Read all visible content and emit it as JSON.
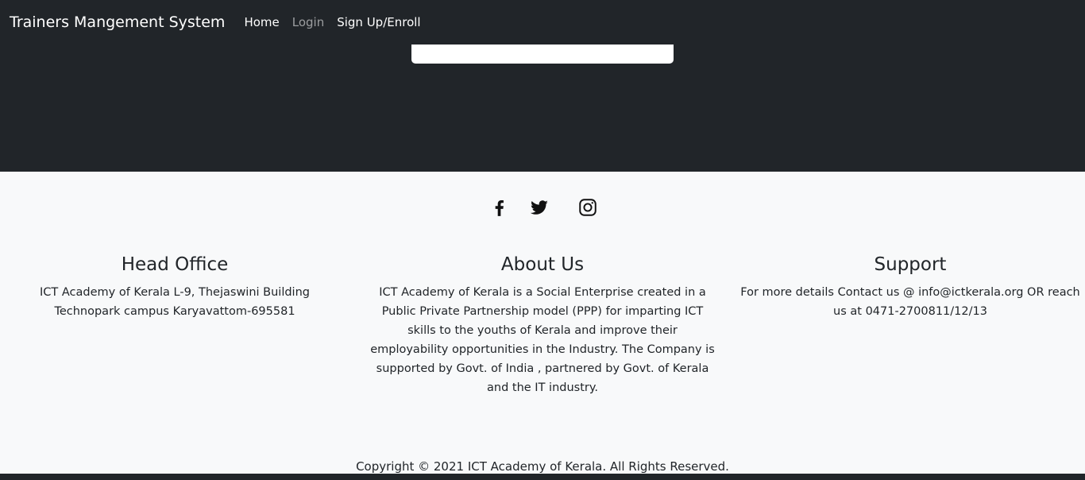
{
  "navbar": {
    "brand": "Trainers Mangement System",
    "links": [
      {
        "label": "Home",
        "state": "active"
      },
      {
        "label": "Login",
        "state": "muted"
      },
      {
        "label": "Sign Up/Enroll",
        "state": "normal"
      }
    ]
  },
  "social": [
    {
      "icon": "facebook-icon"
    },
    {
      "icon": "twitter-icon"
    },
    {
      "icon": "instagram-icon"
    }
  ],
  "footer": {
    "head_office": {
      "title": "Head Office",
      "text": "ICT Academy of Kerala L-9, Thejaswini Building Technopark campus Karyavattom-695581"
    },
    "about": {
      "title": "About Us",
      "text": "ICT Academy of Kerala is a Social Enterprise created in a Public Private Partnership model (PPP) for imparting ICT skills to the youths of Kerala and improve their employability opportunities in the Industry. The Company is supported by Govt. of India , partnered by Govt. of Kerala and the IT industry."
    },
    "support": {
      "title": "Support",
      "text": "For more details Contact us @ info@ictkerala.org OR reach us at 0471-2700811/12/13"
    },
    "copyright": "Copyright © 2021 ICT Academy of Kerala. All Rights Reserved."
  },
  "colors": {
    "dark": "#212529",
    "light": "#f8f9fa",
    "white": "#ffffff"
  }
}
